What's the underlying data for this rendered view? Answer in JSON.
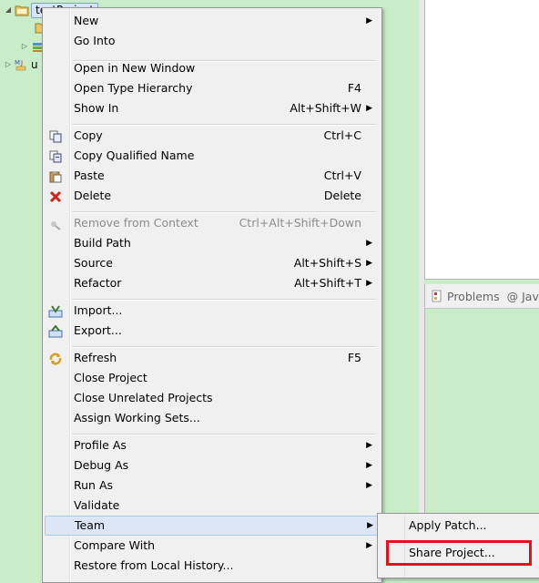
{
  "tree": {
    "project_label": "testProject",
    "second_item_label": "u"
  },
  "problems_view": {
    "tab_problems": "Problems",
    "tab_javadoc": "@ Jav"
  },
  "context_menu": {
    "items": [
      {
        "label": "New",
        "shortcut": "",
        "submenu": true,
        "icon": "",
        "disabled": false
      },
      {
        "label": "Go Into",
        "shortcut": "",
        "submenu": false,
        "icon": "",
        "disabled": false
      },
      {
        "label": "Open in New Window",
        "shortcut": "",
        "submenu": false,
        "icon": "",
        "disabled": false
      },
      {
        "label": "Open Type Hierarchy",
        "shortcut": "F4",
        "submenu": false,
        "icon": "",
        "disabled": false
      },
      {
        "label": "Show In",
        "shortcut": "Alt+Shift+W",
        "submenu": true,
        "icon": "",
        "disabled": false
      },
      {
        "label": "Copy",
        "shortcut": "Ctrl+C",
        "submenu": false,
        "icon": "copy-icon",
        "disabled": false
      },
      {
        "label": "Copy Qualified Name",
        "shortcut": "",
        "submenu": false,
        "icon": "copy-qualified-name-icon",
        "disabled": false
      },
      {
        "label": "Paste",
        "shortcut": "Ctrl+V",
        "submenu": false,
        "icon": "paste-icon",
        "disabled": false
      },
      {
        "label": "Delete",
        "shortcut": "Delete",
        "submenu": false,
        "icon": "delete-icon",
        "disabled": false
      },
      {
        "label": "Remove from Context",
        "shortcut": "Ctrl+Alt+Shift+Down",
        "submenu": false,
        "icon": "remove-from-context-icon",
        "disabled": true
      },
      {
        "label": "Build Path",
        "shortcut": "",
        "submenu": true,
        "icon": "",
        "disabled": false
      },
      {
        "label": "Source",
        "shortcut": "Alt+Shift+S",
        "submenu": true,
        "icon": "",
        "disabled": false
      },
      {
        "label": "Refactor",
        "shortcut": "Alt+Shift+T",
        "submenu": true,
        "icon": "",
        "disabled": false
      },
      {
        "label": "Import...",
        "shortcut": "",
        "submenu": false,
        "icon": "import-icon",
        "disabled": false
      },
      {
        "label": "Export...",
        "shortcut": "",
        "submenu": false,
        "icon": "export-icon",
        "disabled": false
      },
      {
        "label": "Refresh",
        "shortcut": "F5",
        "submenu": false,
        "icon": "refresh-icon",
        "disabled": false
      },
      {
        "label": "Close Project",
        "shortcut": "",
        "submenu": false,
        "icon": "",
        "disabled": false
      },
      {
        "label": "Close Unrelated Projects",
        "shortcut": "",
        "submenu": false,
        "icon": "",
        "disabled": false
      },
      {
        "label": "Assign Working Sets...",
        "shortcut": "",
        "submenu": false,
        "icon": "",
        "disabled": false
      },
      {
        "label": "Profile As",
        "shortcut": "",
        "submenu": true,
        "icon": "",
        "disabled": false
      },
      {
        "label": "Debug As",
        "shortcut": "",
        "submenu": true,
        "icon": "",
        "disabled": false
      },
      {
        "label": "Run As",
        "shortcut": "",
        "submenu": true,
        "icon": "",
        "disabled": false
      },
      {
        "label": "Validate",
        "shortcut": "",
        "submenu": false,
        "icon": "",
        "disabled": false
      },
      {
        "label": "Team",
        "shortcut": "",
        "submenu": true,
        "icon": "",
        "disabled": false,
        "highlighted": true
      },
      {
        "label": "Compare With",
        "shortcut": "",
        "submenu": true,
        "icon": "",
        "disabled": false
      },
      {
        "label": "Restore from Local History...",
        "shortcut": "",
        "submenu": false,
        "icon": "",
        "disabled": false
      }
    ],
    "submenu_arrow": "▶"
  },
  "team_submenu": {
    "items": [
      {
        "label": "Apply Patch..."
      },
      {
        "label": "Share Project..."
      }
    ]
  },
  "colors": {
    "background_green": "#c9ecc9",
    "menu_bg": "#f0f0f0",
    "highlight_box": "#e0141c"
  }
}
